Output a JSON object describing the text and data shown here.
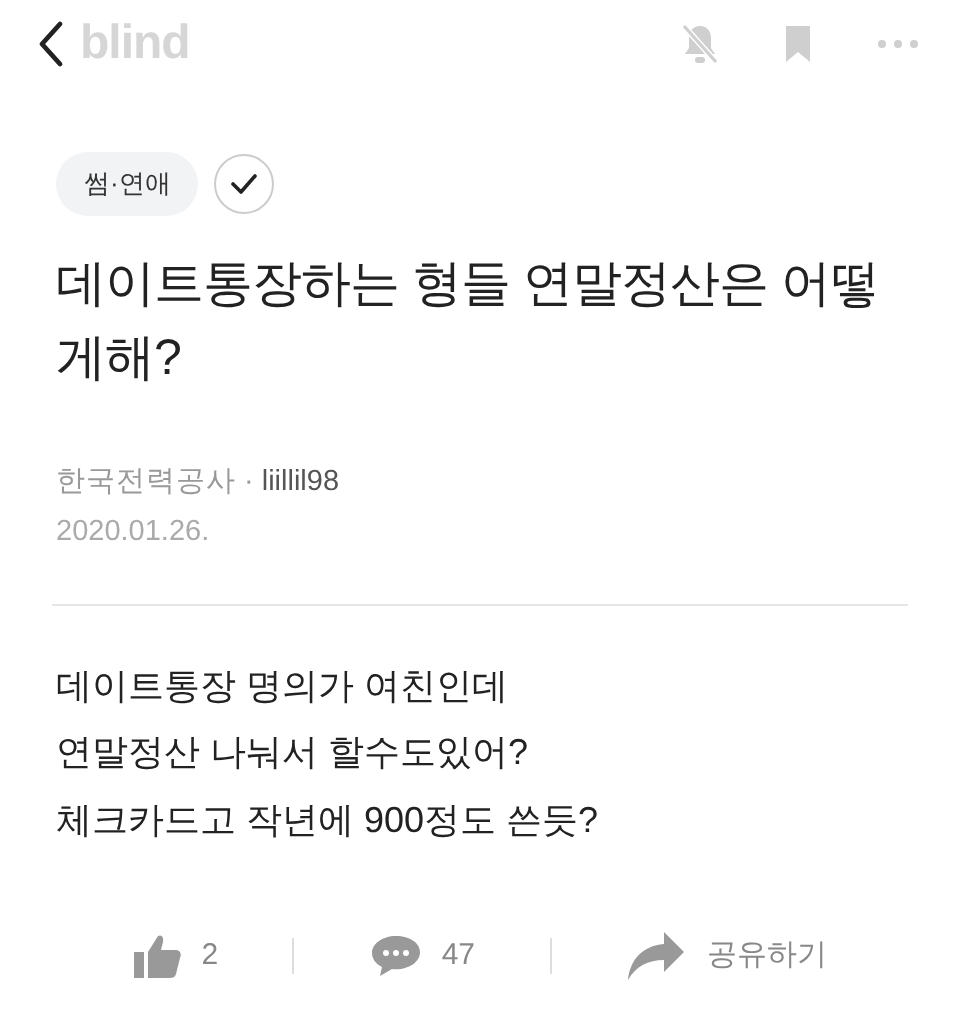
{
  "header": {
    "logo": "blind"
  },
  "category": {
    "label": "썸·연애",
    "verified": true
  },
  "title": "데이트통장하는 형들 연말정산은 어떻게해?",
  "author": {
    "company": "한국전력공사",
    "separator": "·",
    "nickname": "liillil98"
  },
  "date": "2020.01.26.",
  "body": [
    "데이트통장 명의가 여친인데",
    "연말정산 나눠서 할수도있어?",
    "체크카드고 작년에 900정도 쓴듯?"
  ],
  "actions": [
    {
      "kind": "like",
      "label": "2"
    },
    {
      "kind": "comment",
      "label": "47"
    },
    {
      "kind": "share",
      "label": "공유하기"
    }
  ]
}
